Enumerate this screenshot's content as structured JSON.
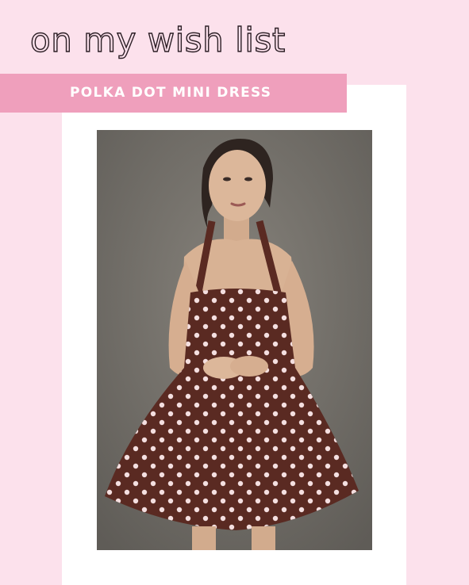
{
  "header": {
    "title": "on my wish list"
  },
  "banner": {
    "label": "POLKA DOT MINI DRESS"
  },
  "photo": {
    "icon": "dress-photo",
    "colors": {
      "background": "#7a7670",
      "dress": "#5a2a22",
      "dots": "#f4dfe0",
      "skin": "#dcb79a",
      "hair": "#2e2420"
    }
  },
  "colors": {
    "page_background": "#fce1ec",
    "banner": "#ef9fbc",
    "card": "#ffffff",
    "title_outline": "#2a1d24"
  }
}
